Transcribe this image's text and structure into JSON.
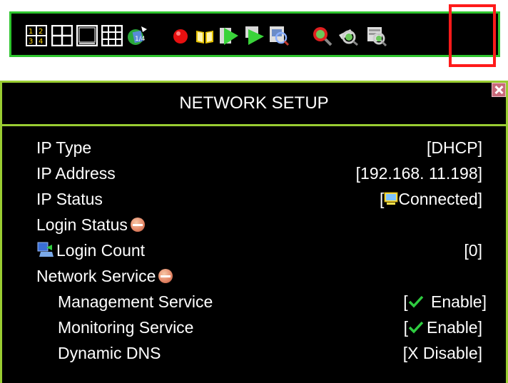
{
  "toolbar": {
    "icons": [
      "layout-4-split-icon",
      "layout-quad-icon",
      "layout-single-icon",
      "layout-9-split-icon",
      "sequence-icon",
      "record-icon",
      "book-icon",
      "play-icon",
      "playback-icon",
      "search-video-icon",
      "zoom-red-icon",
      "zoom-camera-icon",
      "network-search-icon"
    ]
  },
  "network_setup": {
    "title": "NETWORK SETUP",
    "rows": [
      {
        "label": "IP Type",
        "value": "[DHCP]"
      },
      {
        "label": "IP Address",
        "value": "[192.168. 11.198]"
      },
      {
        "label": "IP Status",
        "value_prefix": "[",
        "value": "Connected]"
      },
      {
        "label": "Login Status"
      },
      {
        "label": "Login Count",
        "value": "[0]"
      },
      {
        "label": "Network Service"
      },
      {
        "label": "Management Service",
        "value_prefix": "[",
        "value": " Enable]"
      },
      {
        "label": "Monitoring Service",
        "value_prefix": "[",
        "value": "Enable]"
      },
      {
        "label": "Dynamic DNS",
        "value": "[X Disable]"
      }
    ]
  },
  "colors": {
    "toolbar_border": "#2ec52e",
    "panel_border": "#9acd32",
    "highlight": "#ff1a1a",
    "check": "#2ecc40"
  }
}
